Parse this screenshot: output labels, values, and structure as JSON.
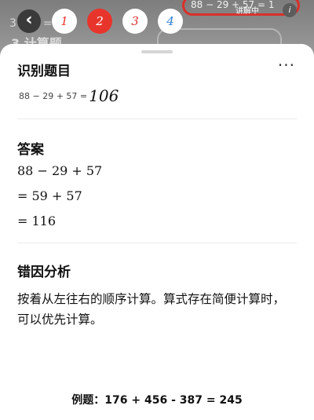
{
  "background": {
    "text_left_1": "3 + 4 = ",
    "text_left_2": "3 计算题",
    "equation": "88 − 29 + 57 = 1",
    "badge": "讲解中",
    "info_icon": "i"
  },
  "nav": {
    "back_icon": "‹",
    "pages": [
      "1",
      "2",
      "3",
      "4"
    ],
    "active_index": 1,
    "page_colors": [
      "#e8352c",
      "#ffffff",
      "#d9302b",
      "#2f7fd0"
    ]
  },
  "sheet": {
    "more": "···",
    "recognize": {
      "title": "识别题目",
      "printed": "88 − 29 + 57 =",
      "handwritten": "106"
    },
    "answer": {
      "title": "答案",
      "lines": [
        "88 − 29 + 57",
        "= 59 + 57",
        "= 116"
      ]
    },
    "analysis": {
      "title": "错因分析",
      "text": "按着从左往右的顺序计算。算式存在简便计算时，可以优先计算。"
    },
    "example": "例题：176 + 456 - 387 = 245"
  }
}
